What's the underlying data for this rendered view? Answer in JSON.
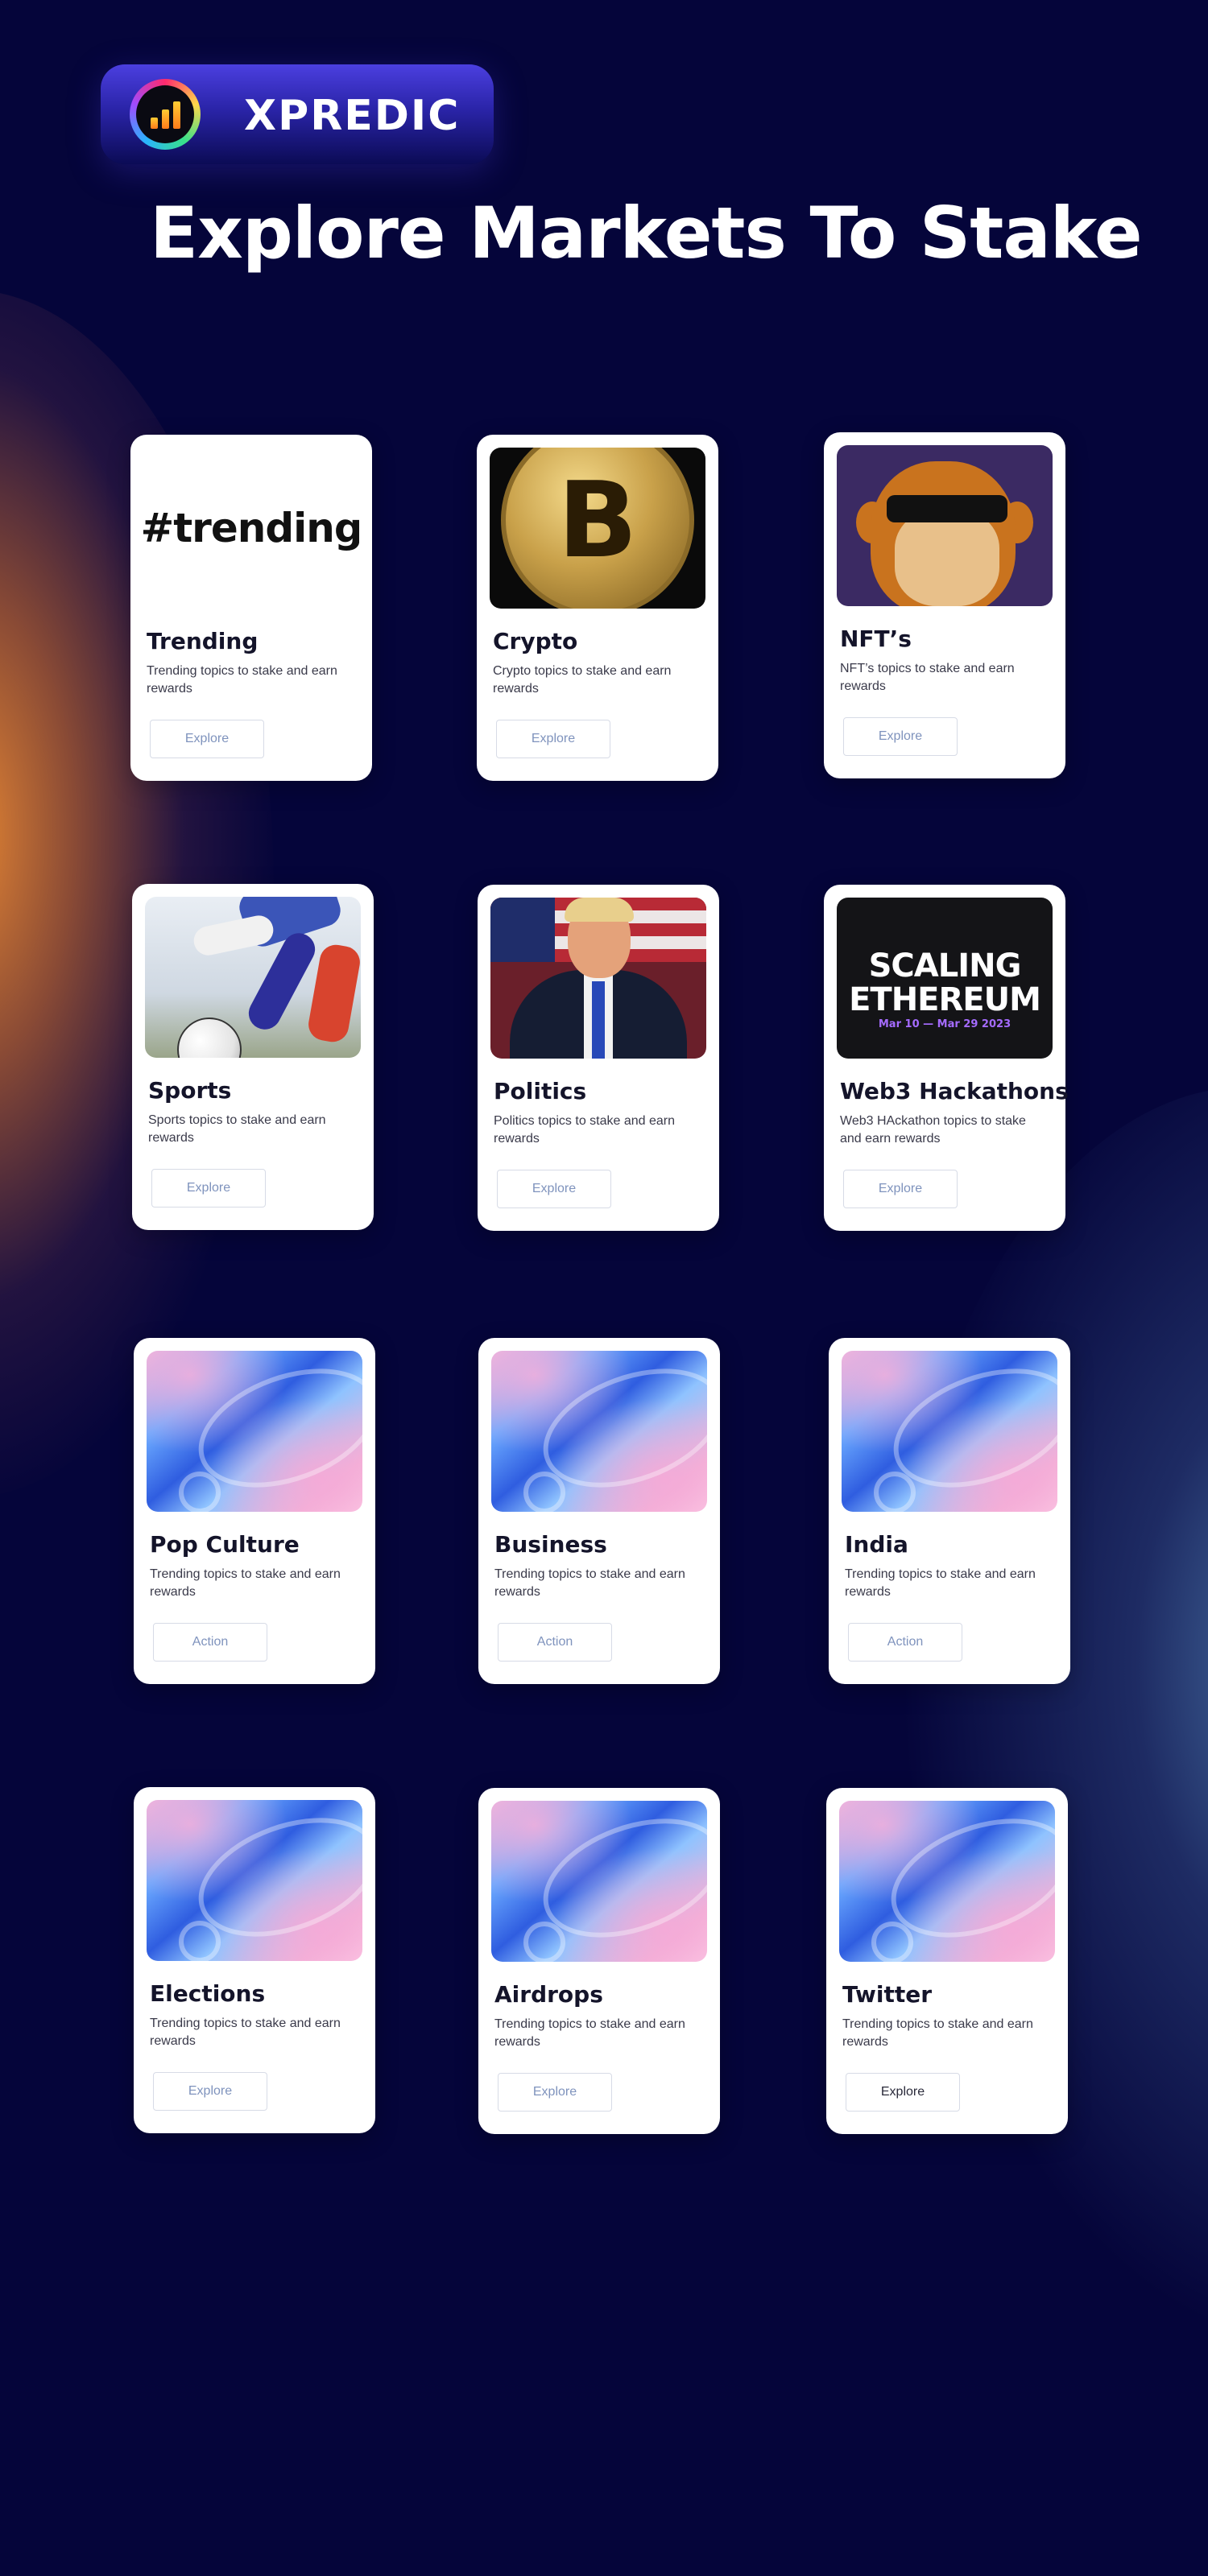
{
  "brand": {
    "name": "XPREDIC"
  },
  "hero": {
    "title": "Explore Markets To Stake"
  },
  "cards": [
    {
      "title": "Trending",
      "description": "Trending topics to stake and earn rewards",
      "button": "Explore",
      "image_text": "#trending"
    },
    {
      "title": "Crypto",
      "description": "Crypto topics to stake and earn rewards",
      "button": "Explore",
      "image_text": "B"
    },
    {
      "title": "NFT’s",
      "description": "NFT’s topics to stake and earn rewards",
      "button": "Explore"
    },
    {
      "title": "Sports",
      "description": "Sports topics to stake and earn rewards",
      "button": "Explore"
    },
    {
      "title": "Politics",
      "description": "Politics topics to stake and earn rewards",
      "button": "Explore"
    },
    {
      "title": "Web3 Hackathons",
      "description": "Web3 HAckathon topics to stake and earn rewards",
      "button": "Explore",
      "image_text": {
        "line1": "SCALING",
        "line2": "ETHEREUM",
        "date": "Mar 10 — Mar 29 2023"
      }
    },
    {
      "title": "Pop Culture",
      "description": "Trending topics to stake and earn rewards",
      "button": "Action"
    },
    {
      "title": "Business",
      "description": "Trending topics to stake and earn rewards",
      "button": "Action"
    },
    {
      "title": "India",
      "description": "Trending topics to stake and earn rewards",
      "button": "Action"
    },
    {
      "title": "Elections",
      "description": "Trending topics to stake and earn rewards",
      "button": "Explore"
    },
    {
      "title": "Airdrops",
      "description": "Trending topics to stake and earn rewards",
      "button": "Explore"
    },
    {
      "title": "Twitter",
      "description": "Trending topics to stake and earn rewards",
      "button": "Explore"
    }
  ],
  "colors": {
    "background": "#05053a",
    "accent": "#4b3fe0",
    "glow_orange": "#f08c32",
    "glow_blue": "#5a8cbe",
    "button_text": "#7f93bd"
  },
  "icons": {
    "logo": "rising-bars-logo-icon"
  }
}
